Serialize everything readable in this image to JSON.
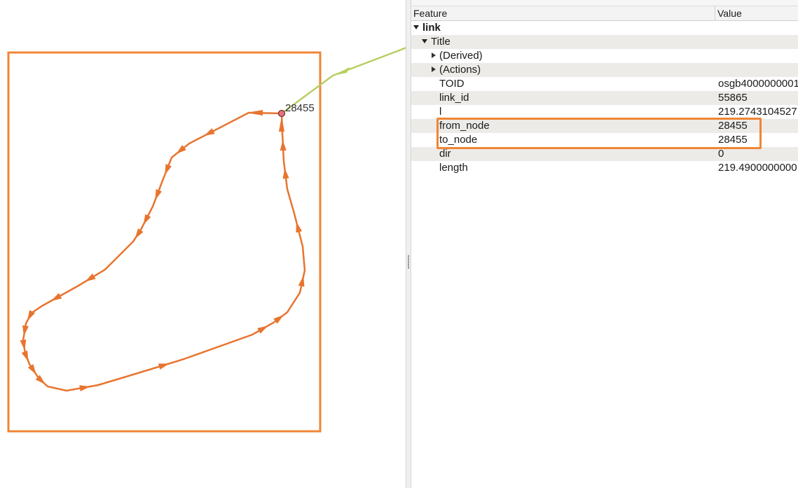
{
  "map": {
    "node_label": "28455",
    "colors": {
      "frame": "#f08535",
      "link": "#e8742e",
      "leader": "#b7cf62",
      "node_fill": "#e8707a",
      "node_stroke": "#6b2c2c"
    }
  },
  "panel": {
    "headers": {
      "feature": "Feature",
      "value": "Value"
    },
    "tree": {
      "root": "link",
      "title": "Title",
      "derived": "(Derived)",
      "actions": "(Actions)"
    },
    "attributes": [
      {
        "name": "TOID",
        "value": "osgb4000000001"
      },
      {
        "name": "link_id",
        "value": "55865"
      },
      {
        "name": "l",
        "value": "219.2743104527"
      },
      {
        "name": "from_node",
        "value": "28455"
      },
      {
        "name": "to_node",
        "value": "28455"
      },
      {
        "name": "dir",
        "value": "0"
      },
      {
        "name": "length",
        "value": "219.4900000000"
      }
    ],
    "highlight_color": "#f08535"
  }
}
